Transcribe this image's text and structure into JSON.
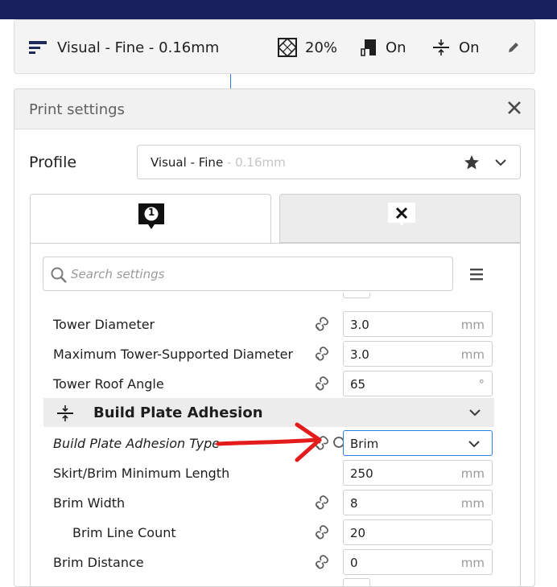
{
  "summary_bar": {
    "profile_label": "Visual - Fine - 0.16mm",
    "infill_value": "20%",
    "support_value": "On",
    "adhesion_value": "On",
    "icons": [
      "profile-lines-icon",
      "infill-icon",
      "support-icon",
      "adhesion-icon",
      "pencil-icon"
    ]
  },
  "panel": {
    "title": "Print settings",
    "profile_label": "Profile",
    "profile_name": "Visual - Fine",
    "profile_layer": " - 0.16mm",
    "tabs": [
      {
        "badge": "1",
        "icon": "extruder-badge-icon"
      },
      {
        "icon": "disabled-extruder-icon"
      }
    ],
    "search_placeholder": "Search settings"
  },
  "settings": {
    "rows": [
      {
        "label": "Tower Diameter",
        "value": "3.0",
        "unit": "mm"
      },
      {
        "label": "Maximum Tower-Supported Diameter",
        "value": "3.0",
        "unit": "mm"
      },
      {
        "label": "Tower Roof Angle",
        "value": "65",
        "unit": "°"
      }
    ],
    "section": {
      "label": "Build Plate Adhesion"
    },
    "adhesion_rows": [
      {
        "label": "Build Plate Adhesion Type",
        "value": "Brim"
      },
      {
        "label": "Skirt/Brim Minimum Length",
        "value": "250",
        "unit": "mm"
      },
      {
        "label": "Brim Width",
        "value": "8",
        "unit": "mm"
      },
      {
        "label": "Brim Line Count",
        "value": "20",
        "unit": ""
      },
      {
        "label": "Brim Distance",
        "value": "0",
        "unit": "mm"
      }
    ]
  },
  "colors": {
    "top_band": "#18205b",
    "accent_blue": "#2c7fe0",
    "annotation_arrow": "#e31b1b"
  }
}
